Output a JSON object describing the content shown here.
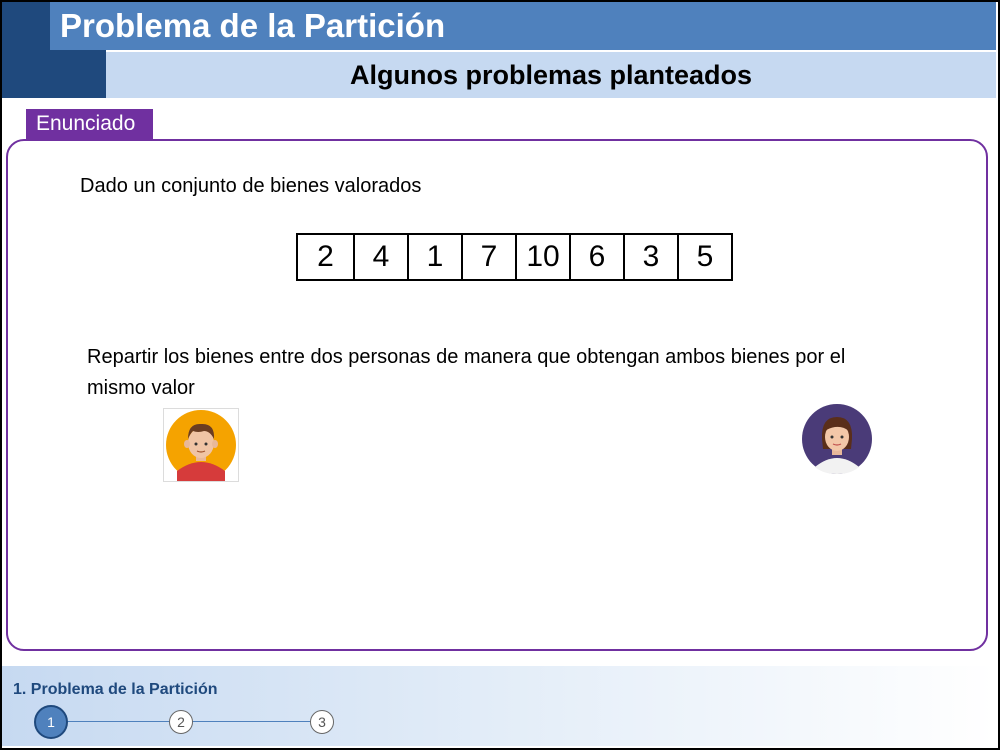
{
  "header": {
    "title": "Problema de la Partición",
    "subtitle": "Algunos problemas planteados"
  },
  "tab": {
    "label": "Enunciado"
  },
  "content": {
    "intro": "Dado un conjunto de bienes valorados",
    "values": [
      "2",
      "4",
      "1",
      "7",
      "10",
      "6",
      "3",
      "5"
    ],
    "task": "Repartir los bienes entre dos personas de manera que obtengan ambos bienes por el mismo valor",
    "avatars": [
      "man-avatar-icon",
      "woman-avatar-icon"
    ]
  },
  "footer": {
    "section_title": "1. Problema de la Partición",
    "steps": [
      "1",
      "2",
      "3"
    ],
    "active_step": "1"
  },
  "colors": {
    "dark_blue": "#1f497d",
    "mid_blue": "#4f81bd",
    "light_blue": "#c6d9f1",
    "purple": "#7030a0"
  }
}
